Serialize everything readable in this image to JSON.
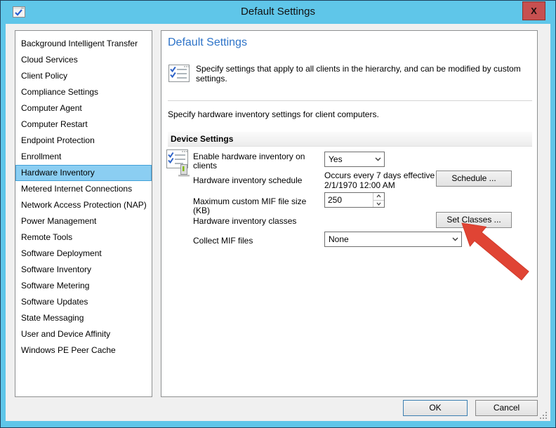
{
  "window": {
    "title": "Default Settings",
    "close_glyph": "X"
  },
  "sidebar": {
    "selected": "Hardware Inventory",
    "items": [
      {
        "label": "Background Intelligent Transfer"
      },
      {
        "label": "Cloud Services"
      },
      {
        "label": "Client Policy"
      },
      {
        "label": "Compliance Settings"
      },
      {
        "label": "Computer Agent"
      },
      {
        "label": "Computer Restart"
      },
      {
        "label": "Endpoint Protection"
      },
      {
        "label": "Enrollment"
      },
      {
        "label": "Hardware Inventory"
      },
      {
        "label": "Metered Internet Connections"
      },
      {
        "label": "Network Access Protection (NAP)"
      },
      {
        "label": "Power Management"
      },
      {
        "label": "Remote Tools"
      },
      {
        "label": "Software Deployment"
      },
      {
        "label": "Software Inventory"
      },
      {
        "label": "Software Metering"
      },
      {
        "label": "Software Updates"
      },
      {
        "label": "State Messaging"
      },
      {
        "label": "User and Device Affinity"
      },
      {
        "label": "Windows PE Peer Cache"
      }
    ]
  },
  "main": {
    "heading": "Default Settings",
    "intro": "Specify settings that apply to all clients in the hierarchy, and can be modified by custom settings.",
    "subtext": "Specify hardware inventory settings for client computers.",
    "group_title": "Device Settings",
    "rows": {
      "enable": {
        "label": "Enable hardware inventory on clients",
        "value": "Yes"
      },
      "schedule": {
        "label": "Hardware inventory schedule",
        "value": "Occurs every 7 days effective 2/1/1970 12:00 AM",
        "button": "Schedule ..."
      },
      "mif_size": {
        "label": "Maximum custom MIF file size (KB)",
        "value": "250"
      },
      "classes": {
        "label": "Hardware inventory classes",
        "button": "Set Classes ..."
      },
      "collect_mif": {
        "label": "Collect MIF files",
        "value": "None"
      }
    }
  },
  "footer": {
    "ok": "OK",
    "cancel": "Cancel"
  },
  "colors": {
    "titlebar_bg": "#5fc6e9",
    "window_border": "#20405c",
    "close_bg": "#c75050",
    "close_border": "#8a322c",
    "selection_bg": "#8bcef2",
    "selection_border": "#41a0d8",
    "heading_blue": "#2d73c8",
    "arrow_red": "#e04434",
    "content_bg": "#f0f0f0",
    "ok_border": "#3c7fb1"
  }
}
